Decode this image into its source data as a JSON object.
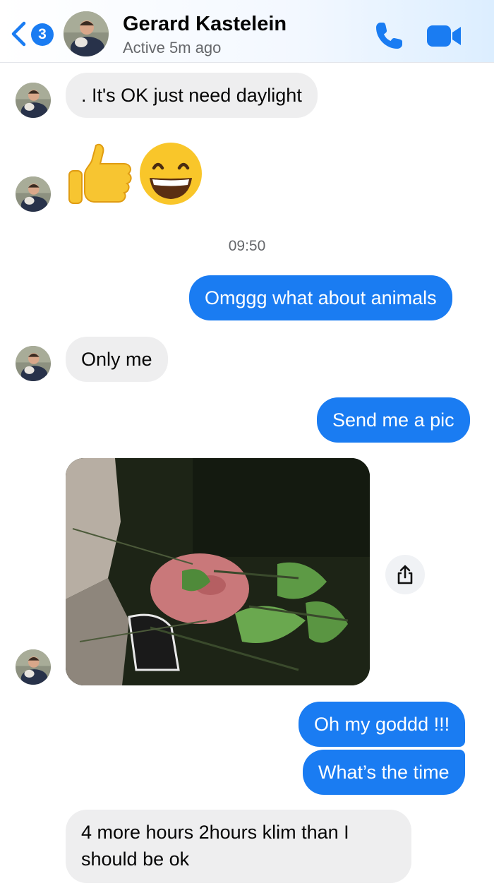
{
  "header": {
    "back_badge": "3",
    "name": "Gerard Kastelein",
    "status": "Active 5m ago",
    "call_icon": "phone-icon",
    "video_icon": "video-camera-icon"
  },
  "colors": {
    "accent": "#1a7cf2",
    "incoming_bubble": "#eeeeef",
    "outgoing_text": "#ffffff"
  },
  "messages": {
    "m1": ". It's OK just need daylight",
    "m2_emojis": "👍😄",
    "time": "09:50",
    "m3": "Omggg what about animals",
    "m4": "Only me",
    "m5": "Send me a pic",
    "m6_image": "night photo of person lying in bushes",
    "m7": "Oh my goddd !!!",
    "m8": "What’s the time",
    "m9": "4 more hours 2hours klim  than I should be ok"
  }
}
